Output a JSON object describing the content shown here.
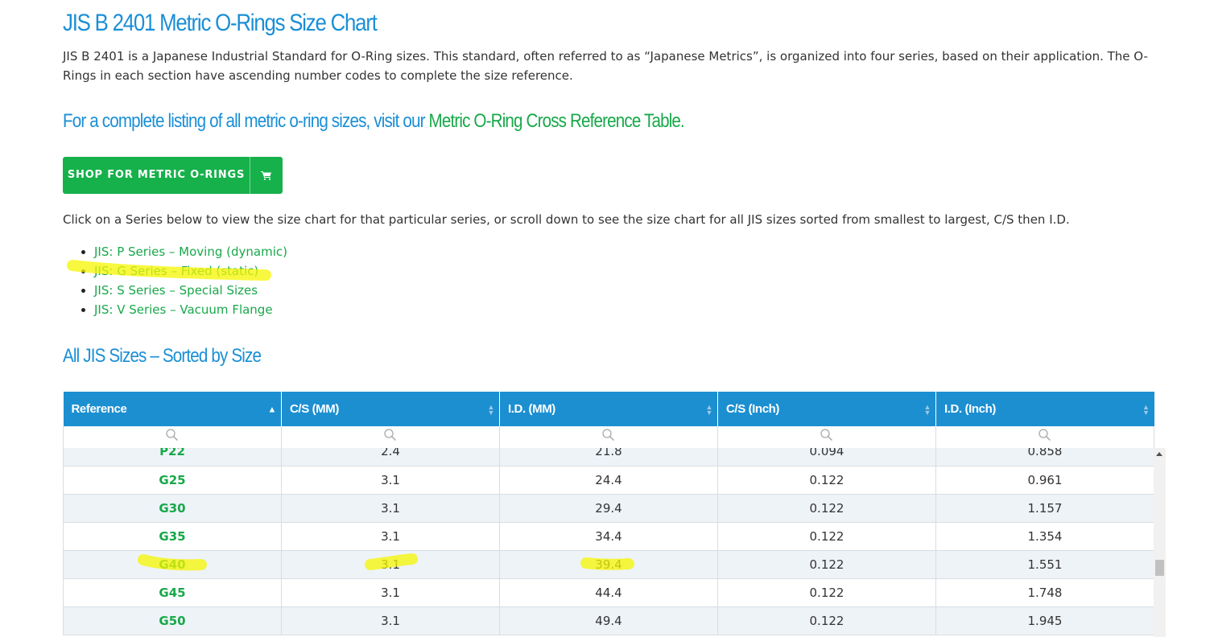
{
  "header": {
    "title": "JIS B 2401 Metric O-Rings Size Chart",
    "intro": "JIS B 2401 is a Japanese Industrial Standard for O-Ring sizes. This standard, often referred to as “Japanese Metrics”, is organized into four series, based on their application. The O-Rings in each section have ascending number codes to complete the size reference."
  },
  "cta": {
    "prefix": "For a complete listing of all metric o-ring sizes, visit our ",
    "link": "Metric O-Ring Cross Reference Table."
  },
  "shop_button": {
    "label": "SHOP FOR METRIC O-RINGS",
    "icon": "cart-icon"
  },
  "help_text": "Click on a Series below to view the size chart for that particular series, or scroll down to see the size chart for all JIS sizes sorted from smallest to largest, C/S then I.D.",
  "series": [
    "JIS: P Series – Moving (dynamic)",
    "JIS: G Series – Fixed (static)",
    "JIS: S Series – Special Sizes",
    "JIS: V Series – Vacuum Flange"
  ],
  "section_title": "All JIS Sizes – Sorted by Size",
  "table": {
    "columns": [
      "Reference",
      "C/S (MM)",
      "I.D. (MM)",
      "C/S (Inch)",
      "I.D. (Inch)"
    ],
    "sorted_column": "Reference",
    "rows": [
      [
        "P22",
        "2.4",
        "21.8",
        "0.094",
        "0.858"
      ],
      [
        "G25",
        "3.1",
        "24.4",
        "0.122",
        "0.961"
      ],
      [
        "G30",
        "3.1",
        "29.4",
        "0.122",
        "1.157"
      ],
      [
        "G35",
        "3.1",
        "34.4",
        "0.122",
        "1.354"
      ],
      [
        "G40",
        "3.1",
        "39.4",
        "0.122",
        "1.551"
      ],
      [
        "G45",
        "3.1",
        "44.4",
        "0.122",
        "1.748"
      ],
      [
        "G50",
        "3.1",
        "49.4",
        "0.122",
        "1.945"
      ]
    ]
  },
  "colors": {
    "heading_blue": "#1a8fd6",
    "link_green": "#18a84a",
    "button_green": "#16b14b",
    "table_header": "#1c8fd1",
    "highlighter": "#f5f500"
  }
}
